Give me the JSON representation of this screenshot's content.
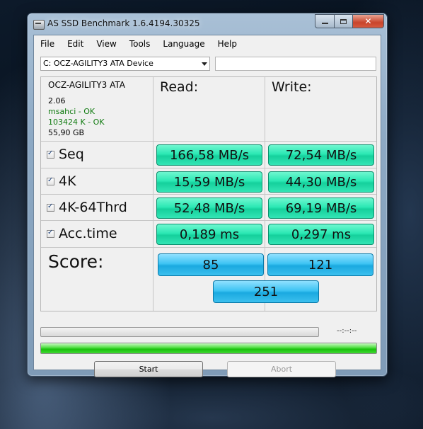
{
  "window": {
    "title": "AS SSD Benchmark 1.6.4194.30325"
  },
  "menu": [
    "File",
    "Edit",
    "View",
    "Tools",
    "Language",
    "Help"
  ],
  "device": {
    "selected": "C: OCZ-AGILITY3 ATA Device"
  },
  "drive_info": {
    "model": "OCZ-AGILITY3 ATA",
    "firmware": "2.06",
    "driver": "msahci - OK",
    "alignment": "103424 K - OK",
    "size": "55,90 GB"
  },
  "headers": {
    "read": "Read:",
    "write": "Write:"
  },
  "rows": [
    {
      "label": "Seq",
      "checked": true,
      "read": "166,58 MB/s",
      "write": "72,54 MB/s"
    },
    {
      "label": "4K",
      "checked": true,
      "read": "15,59 MB/s",
      "write": "44,30 MB/s"
    },
    {
      "label": "4K-64Thrd",
      "checked": true,
      "read": "52,48 MB/s",
      "write": "69,19 MB/s"
    },
    {
      "label": "Acc.time",
      "checked": true,
      "read": "0,189 ms",
      "write": "0,297 ms"
    }
  ],
  "score": {
    "label": "Score:",
    "read": "85",
    "write": "121",
    "total": "251"
  },
  "progress": {
    "time": "--:--:--",
    "overall_fraction": 1.0
  },
  "buttons": {
    "start": "Start",
    "abort": "Abort"
  },
  "colors": {
    "value_box": "#2be8b4",
    "score_box": "#3ec4f3",
    "progress_fill": "#19c20c"
  }
}
